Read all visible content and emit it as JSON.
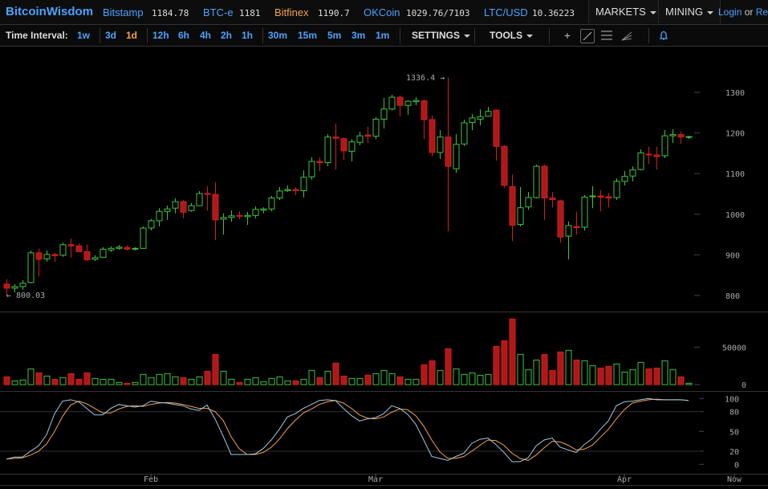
{
  "header": {
    "logo": "BitcoinWisdom",
    "markets": [
      {
        "name": "Bitstamp",
        "price": "1184.78",
        "color": "#4ba3ff"
      },
      {
        "name": "BTC-e",
        "price": "1181",
        "color": "#4ba3ff"
      },
      {
        "name": "Bitfinex",
        "price": "1190.7",
        "color": "#f6a14e"
      },
      {
        "name": "OKCoin",
        "price": "1029.76/7103",
        "color": "#4ba3ff"
      },
      {
        "name": "LTC/USD",
        "price": "10.36223",
        "color": "#4ba3ff"
      }
    ],
    "markets_menu": "MARKETS",
    "mining_menu": "MINING",
    "login": "Login",
    "or": "or",
    "register": "Re"
  },
  "toolbar": {
    "time_interval_label": "Time Interval:",
    "intervals": [
      "1w",
      "3d",
      "1d",
      "12h",
      "6h",
      "4h",
      "2h",
      "1h",
      "30m",
      "15m",
      "5m",
      "3m",
      "1m"
    ],
    "active_interval": "1d",
    "settings": "SETTINGS",
    "tools": "TOOLS",
    "icons": [
      "crosshair-icon",
      "trendline-icon",
      "horizontal-lines-icon",
      "fan-icon",
      "bell-icon"
    ]
  },
  "chart_data": {
    "type": "candlestick",
    "colors": {
      "up": "#3fc43f",
      "down": "#b01818",
      "stoch_k": "#9ccbe0",
      "stoch_d": "#f6a14e"
    },
    "price_axis": {
      "ticks": [
        800,
        900,
        1000,
        1100,
        1200,
        1300
      ],
      "range": [
        800,
        1336.4
      ]
    },
    "annotations": {
      "high": "1336.4 →",
      "low": "← 800.03"
    },
    "volume_axis": {
      "ticks": [
        "0",
        "50000"
      ]
    },
    "stoch_axis": {
      "ticks": [
        "0",
        "20",
        "50",
        "80",
        "100"
      ]
    },
    "x_labels": [
      {
        "label": "Feb",
        "index": 18
      },
      {
        "label": "Mar",
        "index": 46
      },
      {
        "label": "Apr",
        "index": 77
      },
      {
        "label": "Now",
        "index": 90.7
      }
    ],
    "ohlc": [
      [
        828,
        840,
        800,
        818
      ],
      [
        818,
        828,
        808,
        822
      ],
      [
        822,
        838,
        814,
        830
      ],
      [
        832,
        911,
        830,
        905
      ],
      [
        905,
        915,
        847,
        889
      ],
      [
        890,
        911,
        883,
        901
      ],
      [
        901,
        905,
        883,
        898
      ],
      [
        899,
        930,
        895,
        925
      ],
      [
        925,
        940,
        893,
        922
      ],
      [
        922,
        928,
        907,
        908
      ],
      [
        908,
        926,
        885,
        888
      ],
      [
        889,
        899,
        885,
        893
      ],
      [
        894,
        919,
        893,
        914
      ],
      [
        912,
        921,
        907,
        916
      ],
      [
        916,
        924,
        913,
        919
      ],
      [
        918,
        923,
        911,
        914
      ],
      [
        914,
        919,
        911,
        916
      ],
      [
        916,
        970,
        915,
        966
      ],
      [
        966,
        988,
        960,
        984
      ],
      [
        984,
        1015,
        970,
        1007
      ],
      [
        1007,
        1021,
        986,
        1013
      ],
      [
        1015,
        1039,
        1002,
        1031
      ],
      [
        1031,
        1035,
        990,
        1005
      ],
      [
        1009,
        1027,
        1006,
        1021
      ],
      [
        1021,
        1057,
        1021,
        1051
      ],
      [
        1051,
        1069,
        1009,
        1049
      ],
      [
        1049,
        1079,
        936,
        986
      ],
      [
        988,
        1002,
        950,
        992
      ],
      [
        992,
        1009,
        982,
        996
      ],
      [
        997,
        1007,
        988,
        995
      ],
      [
        994,
        1006,
        974,
        997
      ],
      [
        997,
        1019,
        990,
        1012
      ],
      [
        1010,
        1017,
        1002,
        1013
      ],
      [
        1013,
        1045,
        1007,
        1040
      ],
      [
        1040,
        1067,
        1035,
        1057
      ],
      [
        1058,
        1071,
        1055,
        1061
      ],
      [
        1061,
        1067,
        1047,
        1058
      ],
      [
        1058,
        1108,
        1041,
        1091
      ],
      [
        1092,
        1140,
        1085,
        1130
      ],
      [
        1130,
        1140,
        1106,
        1127
      ],
      [
        1127,
        1197,
        1118,
        1190
      ],
      [
        1190,
        1223,
        1110,
        1187
      ],
      [
        1186,
        1189,
        1134,
        1156
      ],
      [
        1155,
        1185,
        1130,
        1178
      ],
      [
        1177,
        1203,
        1170,
        1193
      ],
      [
        1195,
        1215,
        1175,
        1192
      ],
      [
        1192,
        1239,
        1185,
        1234
      ],
      [
        1234,
        1286,
        1211,
        1259
      ],
      [
        1259,
        1294,
        1256,
        1288
      ],
      [
        1288,
        1292,
        1241,
        1268
      ],
      [
        1268,
        1280,
        1245,
        1278
      ],
      [
        1277,
        1288,
        1268,
        1280
      ],
      [
        1279,
        1282,
        1185,
        1233
      ],
      [
        1233,
        1243,
        1142,
        1152
      ],
      [
        1152,
        1207,
        1136,
        1190
      ],
      [
        1190,
        1336.4,
        958,
        1118
      ],
      [
        1112,
        1197,
        1102,
        1172
      ],
      [
        1173,
        1233,
        1168,
        1225
      ],
      [
        1226,
        1247,
        1207,
        1237
      ],
      [
        1234,
        1258,
        1219,
        1240
      ],
      [
        1241,
        1264,
        1241,
        1253
      ],
      [
        1256,
        1258,
        1132,
        1167
      ],
      [
        1167,
        1170,
        1065,
        1071
      ],
      [
        1068,
        1098,
        934,
        973
      ],
      [
        975,
        1067,
        970,
        1016
      ],
      [
        1018,
        1055,
        1011,
        1041
      ],
      [
        1041,
        1122,
        1039,
        1118
      ],
      [
        1118,
        1122,
        986,
        1040
      ],
      [
        1040,
        1055,
        1017,
        1036
      ],
      [
        1033,
        1035,
        930,
        944
      ],
      [
        946,
        982,
        889,
        972
      ],
      [
        970,
        1006,
        950,
        967
      ],
      [
        968,
        1047,
        960,
        1042
      ],
      [
        1043,
        1069,
        1015,
        1045
      ],
      [
        1045,
        1059,
        1007,
        1042
      ],
      [
        1043,
        1053,
        1017,
        1040
      ],
      [
        1041,
        1088,
        1035,
        1081
      ],
      [
        1081,
        1106,
        1071,
        1093
      ],
      [
        1094,
        1118,
        1081,
        1109
      ],
      [
        1110,
        1160,
        1108,
        1151
      ],
      [
        1148,
        1166,
        1124,
        1146
      ],
      [
        1146,
        1166,
        1110,
        1142
      ],
      [
        1144,
        1207,
        1138,
        1193
      ],
      [
        1193,
        1209,
        1175,
        1196
      ],
      [
        1196,
        1203,
        1173,
        1190
      ],
      [
        1190,
        1193,
        1185,
        1191
      ]
    ],
    "volume": [
      10400,
      5000,
      6100,
      21000,
      15700,
      11400,
      7100,
      9300,
      14600,
      7100,
      15700,
      8200,
      7100,
      7100,
      2900,
      1800,
      2900,
      13600,
      9300,
      13600,
      14600,
      10400,
      9300,
      7100,
      10400,
      17800,
      40300,
      17800,
      7100,
      2900,
      7100,
      9300,
      3900,
      8200,
      10400,
      5000,
      5000,
      7100,
      18900,
      9300,
      17800,
      28600,
      11400,
      8200,
      8200,
      12500,
      14600,
      18900,
      14600,
      10400,
      7100,
      7100,
      26400,
      31800,
      18900,
      47800,
      21000,
      13600,
      15700,
      12500,
      13600,
      51000,
      58500,
      87500,
      40300,
      20000,
      32800,
      40300,
      18900,
      43600,
      45700,
      32800,
      31800,
      25300,
      22100,
      24300,
      27500,
      16800,
      20000,
      29600,
      21000,
      22100,
      31800,
      20000,
      10400,
      1800
    ],
    "stoch_k": [
      8,
      11,
      11,
      20,
      28,
      45,
      77,
      96,
      98,
      95,
      85,
      75,
      75,
      85,
      91,
      89,
      87,
      89,
      96,
      94,
      93,
      91,
      89,
      84,
      82,
      90,
      69,
      43,
      15,
      15,
      15,
      16,
      24,
      37,
      53,
      72,
      77,
      85,
      91,
      97,
      98,
      97,
      85,
      74,
      66,
      69,
      71,
      77,
      89,
      85,
      76,
      61,
      37,
      12,
      9,
      6,
      12,
      17,
      32,
      38,
      40,
      30,
      18,
      4,
      4,
      10,
      28,
      37,
      40,
      26,
      22,
      18,
      30,
      39,
      53,
      66,
      89,
      95,
      96,
      98,
      100,
      98,
      98,
      98,
      98,
      97
    ],
    "stoch_d": [
      8,
      9,
      10,
      14,
      20,
      31,
      50,
      73,
      90,
      96,
      92,
      85,
      78,
      78,
      84,
      88,
      89,
      88,
      91,
      93,
      94,
      93,
      91,
      88,
      85,
      85,
      80,
      67,
      42,
      24,
      15,
      15,
      18,
      26,
      38,
      54,
      67,
      78,
      84,
      91,
      95,
      97,
      93,
      85,
      75,
      70,
      69,
      72,
      79,
      84,
      83,
      74,
      58,
      37,
      19,
      9,
      9,
      12,
      20,
      29,
      37,
      36,
      29,
      17,
      9,
      6,
      14,
      25,
      35,
      34,
      29,
      22,
      23,
      29,
      41,
      53,
      69,
      83,
      93,
      96,
      98,
      99,
      98,
      98,
      98,
      97
    ]
  }
}
